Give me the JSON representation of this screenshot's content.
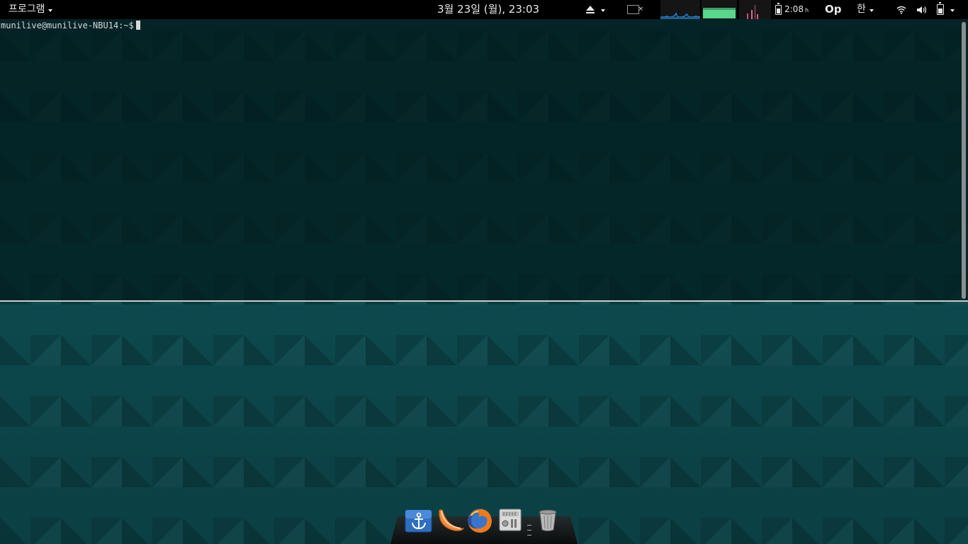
{
  "top_panel": {
    "apps_menu_label": "프로그램",
    "clock": "3월 23일 (월), 23:03",
    "battery_time": "2:08",
    "battery_unit": "h",
    "op_label": "Op",
    "ime_label": "한",
    "icons": {
      "eject": "eject-icon",
      "display": "display-icon",
      "wifi": "wifi-icon",
      "volume": "volume-icon",
      "battery": "battery-icon"
    },
    "monitors": {
      "cpu_graph_color": "#2a82c8",
      "memory_graph_color": "#58d68d",
      "network_graph_color": "#c0508c"
    }
  },
  "terminal": {
    "prompt": "munilive@munilive-NBU14:~$"
  },
  "dock": {
    "items": [
      {
        "name": "anchor-app",
        "icon": "anchor-icon"
      },
      {
        "name": "orange-app",
        "icon": "orange-slice-icon"
      },
      {
        "name": "firefox",
        "icon": "firefox-icon"
      },
      {
        "name": "settings",
        "icon": "settings-panel-icon"
      },
      {
        "name": "trash",
        "icon": "trash-icon"
      }
    ]
  },
  "colors": {
    "panel_background": "#000000",
    "desktop_teal": "#0d4a4f",
    "terminal_text": "#d8d8d8"
  }
}
